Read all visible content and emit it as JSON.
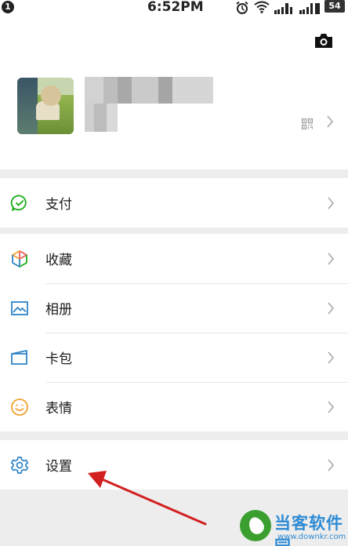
{
  "status_bar": {
    "notification_count": "1",
    "time": "6:52PM",
    "battery": "54",
    "icons": [
      "alarm-icon",
      "wifi-icon",
      "signal-icon",
      "signal-icon"
    ]
  },
  "profile": {
    "camera_icon": "camera-icon",
    "qr_icon": "qr-code-icon",
    "name_obscured": true
  },
  "menu": {
    "pay": {
      "label": "支付",
      "icon": "pay-icon",
      "color": "#1aad19"
    },
    "favorites": {
      "label": "收藏",
      "icon": "favorites-cube-icon"
    },
    "album": {
      "label": "相册",
      "icon": "album-icon",
      "color": "#2e84c7"
    },
    "cards": {
      "label": "卡包",
      "icon": "card-wallet-icon",
      "color": "#2e84c7"
    },
    "stickers": {
      "label": "表情",
      "icon": "smiley-icon",
      "color": "#f0a132"
    },
    "settings": {
      "label": "设置",
      "icon": "gear-icon",
      "color": "#2e84c7"
    }
  },
  "annotation": {
    "arrow_color": "#d21f1f"
  },
  "watermark": {
    "title": "当客软件园",
    "url": "www.downkr.com"
  }
}
